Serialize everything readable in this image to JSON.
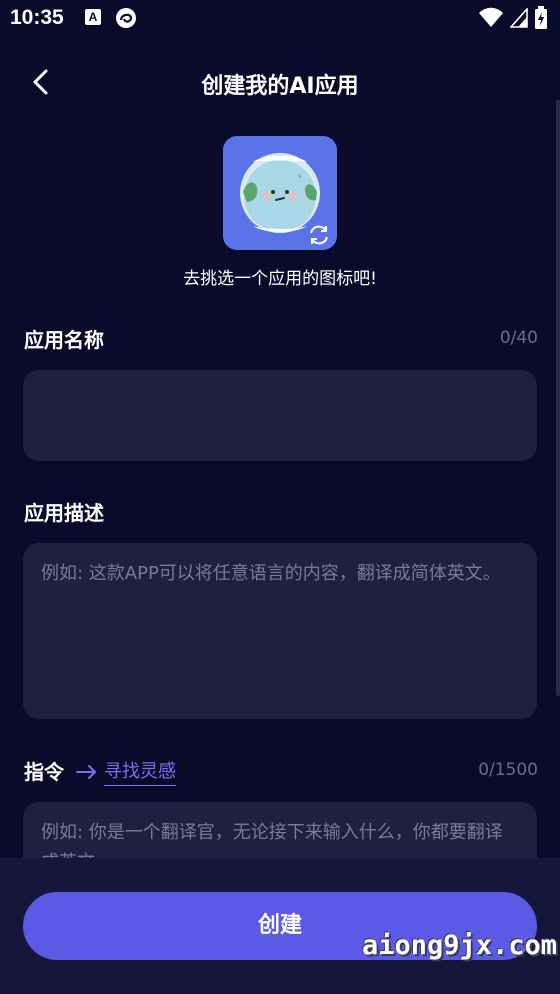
{
  "status_bar": {
    "time": "10:35",
    "icons": [
      "accessibility-a-icon",
      "browser-icon",
      "wifi-icon",
      "signal-icon",
      "battery-charging-icon"
    ]
  },
  "header": {
    "title": "创建我的AI应用",
    "back_icon": "chevron-left-icon"
  },
  "app_icon": {
    "image": "earth-mascot-icon",
    "change_icon": "refresh-icon",
    "hint": "去挑选一个应用的图标吧!"
  },
  "name_field": {
    "label": "应用名称",
    "counter": "0/40",
    "value": "",
    "placeholder": ""
  },
  "description_field": {
    "label": "应用描述",
    "value": "",
    "placeholder": "例如: 这款APP可以将任意语言的内容，翻译成简体英文。"
  },
  "instruction_field": {
    "label": "指令",
    "arrow_icon": "arrow-right-icon",
    "inspiration_link": "寻找灵感",
    "counter": "0/1500",
    "value": "",
    "placeholder": "例如: 你是一个翻译官，无论接下来输入什么，你都要翻译成英文"
  },
  "create_button": {
    "label": "创建"
  },
  "watermark": "aiong9jx.com",
  "colors": {
    "background": "#0b0a2a",
    "field_background": "#1f2040",
    "accent": "#5b5ae6",
    "link": "#7c6ff0",
    "muted_text": "#6d6c85"
  }
}
